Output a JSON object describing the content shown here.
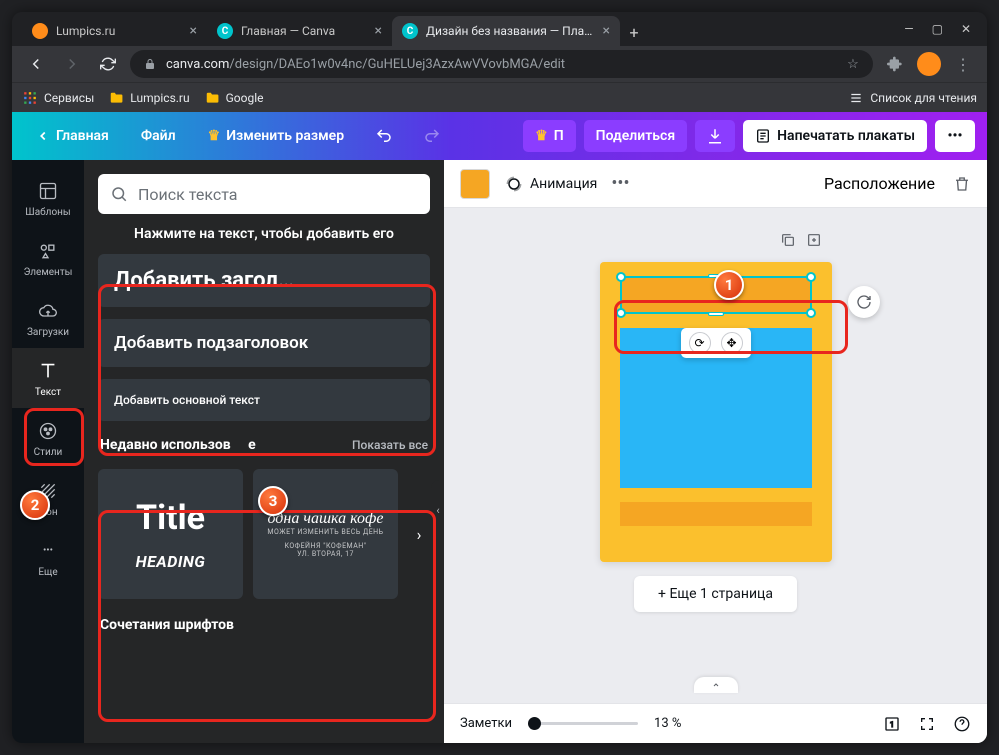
{
  "browser": {
    "tabs": [
      {
        "title": "Lumpics.ru"
      },
      {
        "title": "Главная — Canva"
      },
      {
        "title": "Дизайн без названия — Плака"
      }
    ],
    "url_host": "canva.com",
    "url_path": "/design/DAEo1w0v4nc/GuHELUej3AzxAwVVovbMGA/edit",
    "bookmarks": {
      "services": "Сервисы",
      "lumpics": "Lumpics.ru",
      "google": "Google",
      "reading_list": "Список для чтения"
    }
  },
  "header": {
    "home": "Главная",
    "file": "Файл",
    "resize": "Изменить размер",
    "presenter_short": "П",
    "share": "Поделиться",
    "print": "Напечатать плакаты"
  },
  "rail": {
    "templates": "Шаблоны",
    "elements": "Элементы",
    "uploads": "Загрузки",
    "text": "Текст",
    "styles": "Стили",
    "background": "Фон",
    "more": "Еще"
  },
  "panel": {
    "search_placeholder": "Поиск текста",
    "click_to_add": "Нажмите на текст, чтобы добавить его",
    "add_heading": "Добавить загол…",
    "add_subheading": "Добавить подзаголовок",
    "add_body": "Добавить основной текст",
    "recent": "Недавно использов",
    "recent_suffix": "е",
    "show_all": "Показать все",
    "tile1_title": "Title",
    "tile1_heading": "HEADING",
    "tile2_line1": "одна чашка кофе",
    "tile2_line2": "МОЖЕТ ИЗМЕНИТЬ ВЕСЬ ДЕНЬ",
    "tile2_line3": "КОФЕЙНЯ \"КОФЕМАН\"",
    "tile2_line4": "УЛ. ВТОРАЯ, 17",
    "font_combos": "Сочетания шрифтов"
  },
  "canvas_toolbar": {
    "animation": "Анимация",
    "position": "Расположение"
  },
  "canvas": {
    "add_page": "+ Еще 1 страница"
  },
  "bottom": {
    "notes": "Заметки",
    "zoom": "13 %"
  },
  "annotations": {
    "badge1": "1",
    "badge2": "2",
    "badge3": "3"
  }
}
